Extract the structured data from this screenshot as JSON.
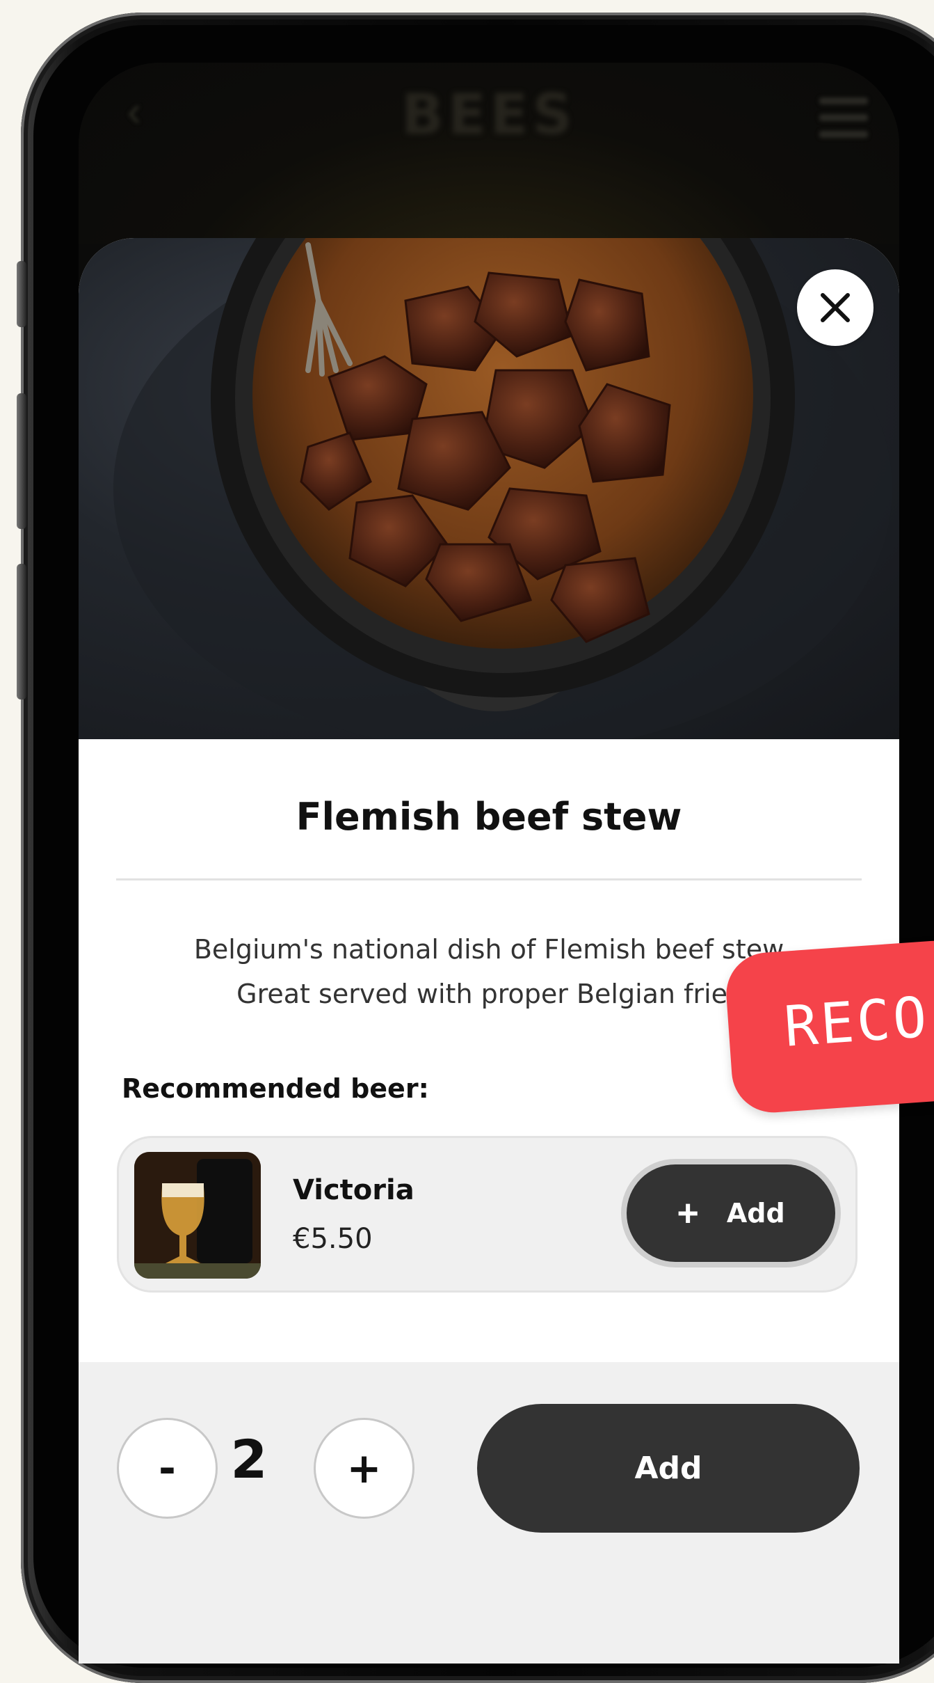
{
  "header": {
    "title": "BEES",
    "back_icon": "chevron-left-icon",
    "menu_icon": "hamburger-menu-icon"
  },
  "dish": {
    "title": "Flemish beef stew",
    "description_line1": "Belgium's national dish of Flemish beef stew",
    "description_line2": "Great served with proper Belgian fries",
    "close_icon": "close-icon"
  },
  "recommendation": {
    "heading": "Recommended beer:",
    "beer": {
      "name": "Victoria",
      "price": "€5.50",
      "add_label": "Add",
      "add_icon": "plus-icon"
    }
  },
  "order": {
    "decrement_label": "-",
    "quantity": "2",
    "increment_label": "+",
    "add_label": "Add"
  },
  "sticker": {
    "text": "RECO"
  },
  "colors": {
    "button_dark": "#333333",
    "sticker_red": "#f5434a",
    "card_bg": "#f0f0f0",
    "page_bg": "#f7f5ee"
  }
}
